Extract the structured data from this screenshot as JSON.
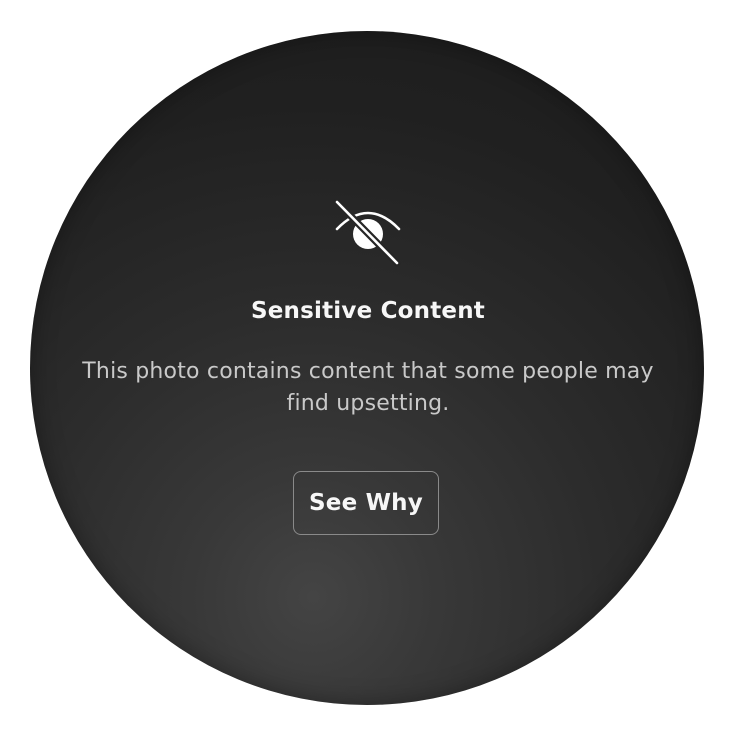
{
  "warning": {
    "icon": "eye-slash-icon",
    "title": "Sensitive Content",
    "message": "This photo contains content that some people may find upsetting.",
    "button_label": "See Why"
  },
  "colors": {
    "overlay": "#1e1e1e",
    "title_text": "#f7f7f7",
    "body_text": "#c9c9c9",
    "button_border": "#8a8a8a"
  }
}
